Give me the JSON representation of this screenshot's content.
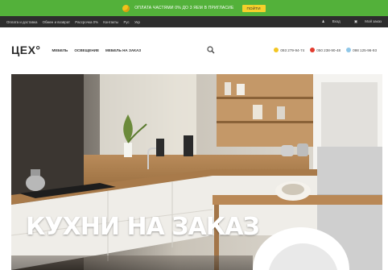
{
  "promo": {
    "text": "ОПЛАТА ЧАСТЯМИ 0% ДО 3 ЯЕМ В ПРИГЛАСИЕ",
    "button": "ПОЙТИ"
  },
  "topbar": {
    "links": [
      "Оплата и доставка",
      "Обмен и возврат",
      "Рассрочка 0%",
      "Контакты",
      "Рус",
      "Укр"
    ],
    "login": "Вход",
    "cart": "Мой заказ"
  },
  "header": {
    "logo": "ЦЕХ°",
    "nav": [
      "МЕБЕЛЬ",
      "ОСВЕЩЕНИЕ",
      "МЕБЕЛЬ НА ЗАКАЗ"
    ],
    "phones": [
      {
        "number": "093 279-94-74",
        "color": "#f3c623"
      },
      {
        "number": "050 238-90-48",
        "color": "#e23b2e"
      },
      {
        "number": "098 125-96-93",
        "color": "#8fc7e8"
      }
    ]
  },
  "hero": {
    "title": "КУХНИ НА ЗАКАЗ"
  },
  "colors": {
    "promo_bg": "#53b13a",
    "topbar_bg": "#2d2d2d",
    "accent_yellow": "#f5d02b"
  }
}
